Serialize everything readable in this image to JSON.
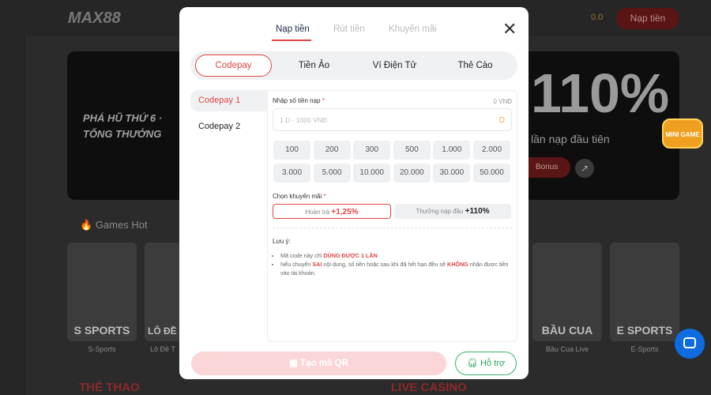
{
  "background": {
    "logo": "MAX88",
    "header_deposit_button": "Nạp tiền",
    "balance": "0.0",
    "banner": {
      "headline_left": "PHÁ HŨ THỨ 6 · TỔNG THƯỞNG",
      "big_text": "110%",
      "subtitle": "lần nạp đầu tiên",
      "bonus_button": "Bonus"
    },
    "games_hot_title": "Games Hot",
    "games": [
      {
        "title": "S SPORTS",
        "label": "S-Sports"
      },
      {
        "title": "LÔ ĐỀ",
        "label": "Lô Đề T"
      },
      {
        "title": "BẦU CUA",
        "label": "Bầu Cua Live"
      },
      {
        "title": "E SPORTS",
        "label": "E-Sports"
      }
    ],
    "section_sports": "THỂ THAO",
    "section_casino": "LIVE CASINO",
    "minigame": "MINI GAME"
  },
  "modal": {
    "tabs": [
      {
        "label": "Nạp tiền",
        "active": true
      },
      {
        "label": "Rút tiền"
      },
      {
        "label": "Khuyến mãi"
      }
    ],
    "close": "✕",
    "methods": [
      {
        "label": "Codepay",
        "active": true
      },
      {
        "label": "Tiền Ảo"
      },
      {
        "label": "Ví Điện Tử"
      },
      {
        "label": "Thẻ Cào"
      }
    ],
    "sub_methods": [
      {
        "label": "Codepay 1",
        "active": true
      },
      {
        "label": "Codepay 2"
      }
    ],
    "amount_label": "Nhập số tiền nạp",
    "required": "*",
    "amount_value": "0 VNĐ",
    "amount_placeholder": "1 D - 1000 VNĐ",
    "currency_suffix": "D",
    "chips": [
      "100",
      "200",
      "300",
      "500",
      "1.000",
      "2.000",
      "3.000",
      "5.000",
      "10.000",
      "20.000",
      "30.000",
      "50.000"
    ],
    "promo_label": "Chọn khuyến mãi",
    "promos": [
      {
        "label": "Hoàn trả",
        "value": "+1,25%",
        "selected": true
      },
      {
        "label": "Thưởng nạp đầu",
        "value": "+110%"
      }
    ],
    "notes_title": "Lưu ý:",
    "note1_pre": "Mã code này chỉ ",
    "note1_hl": "DÙNG ĐƯỢC 1 LẦN",
    "note2_pre": "Nếu chuyển ",
    "note2_hl1": "SAI",
    "note2_mid": " nội dung, số tiền hoặc sau khi đã hết hạn đều sẽ ",
    "note2_hl2": "KHÔNG",
    "note2_post": " nhận được tiền vào tài khoản.",
    "qr_button": "Tạo mã QR",
    "help_button": "Hỗ trợ",
    "accent": "#e04545"
  }
}
